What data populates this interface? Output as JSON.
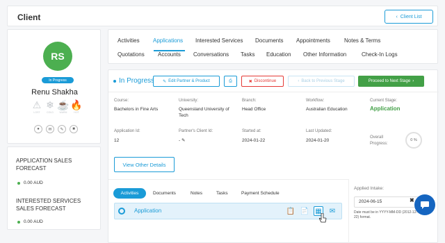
{
  "header": {
    "title": "Client",
    "client_list_label": "Client List"
  },
  "profile": {
    "initials": "RS",
    "status": "In Progress",
    "name": "Renu Shakha",
    "temperatures": [
      {
        "label": "LOST",
        "icon": "warning-icon"
      },
      {
        "label": "COLD",
        "icon": "snowflake-icon"
      },
      {
        "label": "WARM",
        "icon": "coffee-icon"
      },
      {
        "label": "HOT",
        "icon": "flame-icon"
      }
    ],
    "actions": [
      "chat-icon",
      "mail-icon",
      "edit-icon",
      "message-icon"
    ]
  },
  "forecasts": [
    {
      "title": "APPLICATION SALES FORECAST",
      "value": "0.00",
      "currency": "AUD"
    },
    {
      "title": "INTERESTED SERVICES SALES FORECAST",
      "value": "0.00",
      "currency": "AUD"
    }
  ],
  "tabs": {
    "row1": [
      "Activities",
      "Applications",
      "Interested Services",
      "Documents",
      "Appointments",
      "Notes & Terms"
    ],
    "row2": [
      "Quotations",
      "Accounts",
      "Conversations",
      "Tasks",
      "Education",
      "Other Information",
      "Check-In Logs"
    ],
    "active": "Applications"
  },
  "stage": {
    "label": "In Progress",
    "edit_btn": "Edit Partner & Product",
    "discontinue_btn": "Discontinue",
    "prev_btn": "Back to Previous Stage",
    "next_btn": "Proceed to Next Stage",
    "colors": {
      "primary": "#1a9bd7",
      "green": "#43a047",
      "red": "#e53935"
    }
  },
  "details": {
    "course_label": "Course:",
    "course": "Bachelors in Fine Arts",
    "university_label": "University:",
    "university": "Queensland University of Tech",
    "branch_label": "Branch:",
    "branch": "Head Office",
    "workflow_label": "Workflow:",
    "workflow": "Australian Education",
    "current_stage_label": "Current Stage:",
    "current_stage": "Application",
    "app_id_label": "Application Id:",
    "app_id": "12",
    "partner_id_label": "Partner's Client Id:",
    "partner_id": "-",
    "started_label": "Started at:",
    "started": "2024-01-22",
    "updated_label": "Last Updated:",
    "updated": "2024-01-20",
    "overall_label": "Overall Progress:",
    "overall_progress": "0 %"
  },
  "other_details_btn": "View Other Details",
  "subtabs": [
    "Activities",
    "Documents",
    "Notes",
    "Tasks",
    "Payment Schedule"
  ],
  "application_row": {
    "title": "Application"
  },
  "intake": {
    "label": "Applied Intake:",
    "value": "2024-06-15",
    "note": "Date must be in YYYY-MM-DD (2012-12-22) format."
  }
}
